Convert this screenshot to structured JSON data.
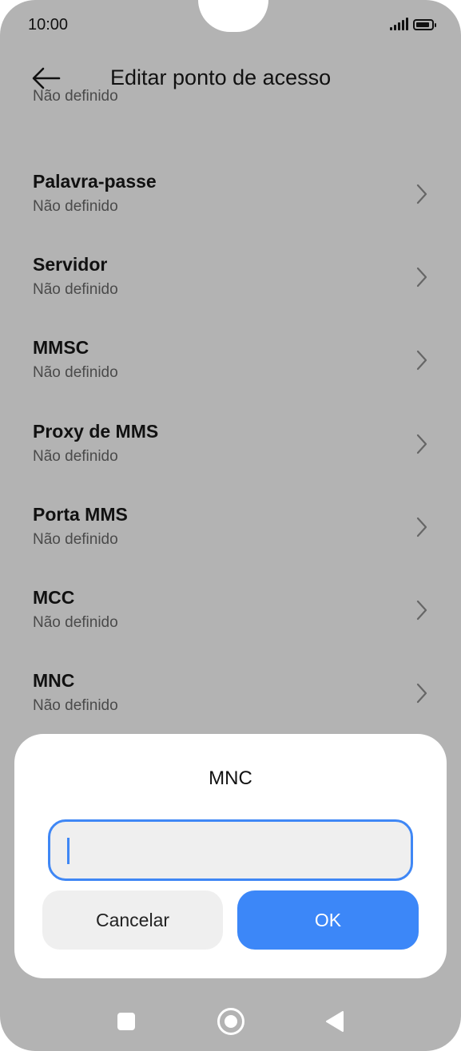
{
  "status_bar": {
    "time": "10:00",
    "signal_icon": "signal-icon",
    "battery_icon": "battery-icon"
  },
  "header": {
    "title": "Editar ponto de acesso",
    "back_icon": "back-arrow-icon"
  },
  "settings": {
    "partial_item_value": "Não definido",
    "items": [
      {
        "label": "Palavra-passe",
        "value": "Não definido"
      },
      {
        "label": "Servidor",
        "value": "Não definido"
      },
      {
        "label": "MMSC",
        "value": "Não definido"
      },
      {
        "label": "Proxy de MMS",
        "value": "Não definido"
      },
      {
        "label": "Porta MMS",
        "value": "Não definido"
      },
      {
        "label": "MCC",
        "value": "Não definido"
      },
      {
        "label": "MNC",
        "value": "Não definido"
      }
    ]
  },
  "dialog": {
    "title": "MNC",
    "input_value": "",
    "cancel_label": "Cancelar",
    "ok_label": "OK"
  },
  "colors": {
    "accent": "#3c87f8",
    "background_dim": "#b3b3b3"
  },
  "nav_bar": {
    "recents_icon": "square-recents-icon",
    "home_icon": "circle-home-icon",
    "back_icon": "triangle-back-icon"
  }
}
